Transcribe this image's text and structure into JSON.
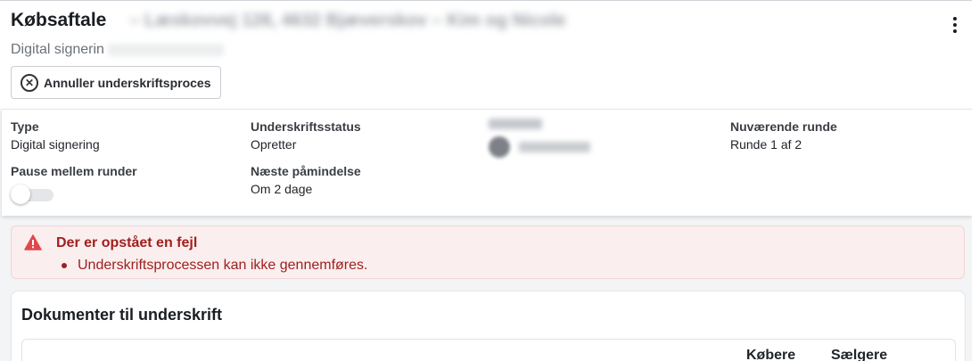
{
  "header": {
    "title": "Købsaftale",
    "title_suffix_blurred": "– Læskovvej 128, 4632 Bjæverskov – Kim og Nicole",
    "subtitle": "Digital signerin",
    "menu_icon": "more-vertical-icon"
  },
  "actions": {
    "cancel_label": "Annuller underskriftsproces",
    "cancel_icon": "circle-x-icon"
  },
  "info": {
    "type_label": "Type",
    "type_value": "Digital signering",
    "status_label": "Underskriftsstatus",
    "status_value": "Opretter",
    "current_round_label": "Nuværende runde",
    "current_round_value": "Runde 1 af 2",
    "pause_label": "Pause mellem runder",
    "pause_enabled": false,
    "next_reminder_label": "Næste påmindelse",
    "next_reminder_value": "Om 2 dage"
  },
  "error": {
    "title": "Der er opstået en fejl",
    "items": [
      "Underskriftsprocessen kan ikke gennemføres."
    ],
    "icon": "warning-triangle-icon",
    "color": "#a01f1f",
    "background": "#fbeeee"
  },
  "documents": {
    "title": "Dokumenter til underskrift",
    "columns": [
      "Købere",
      "Sælgere"
    ]
  }
}
